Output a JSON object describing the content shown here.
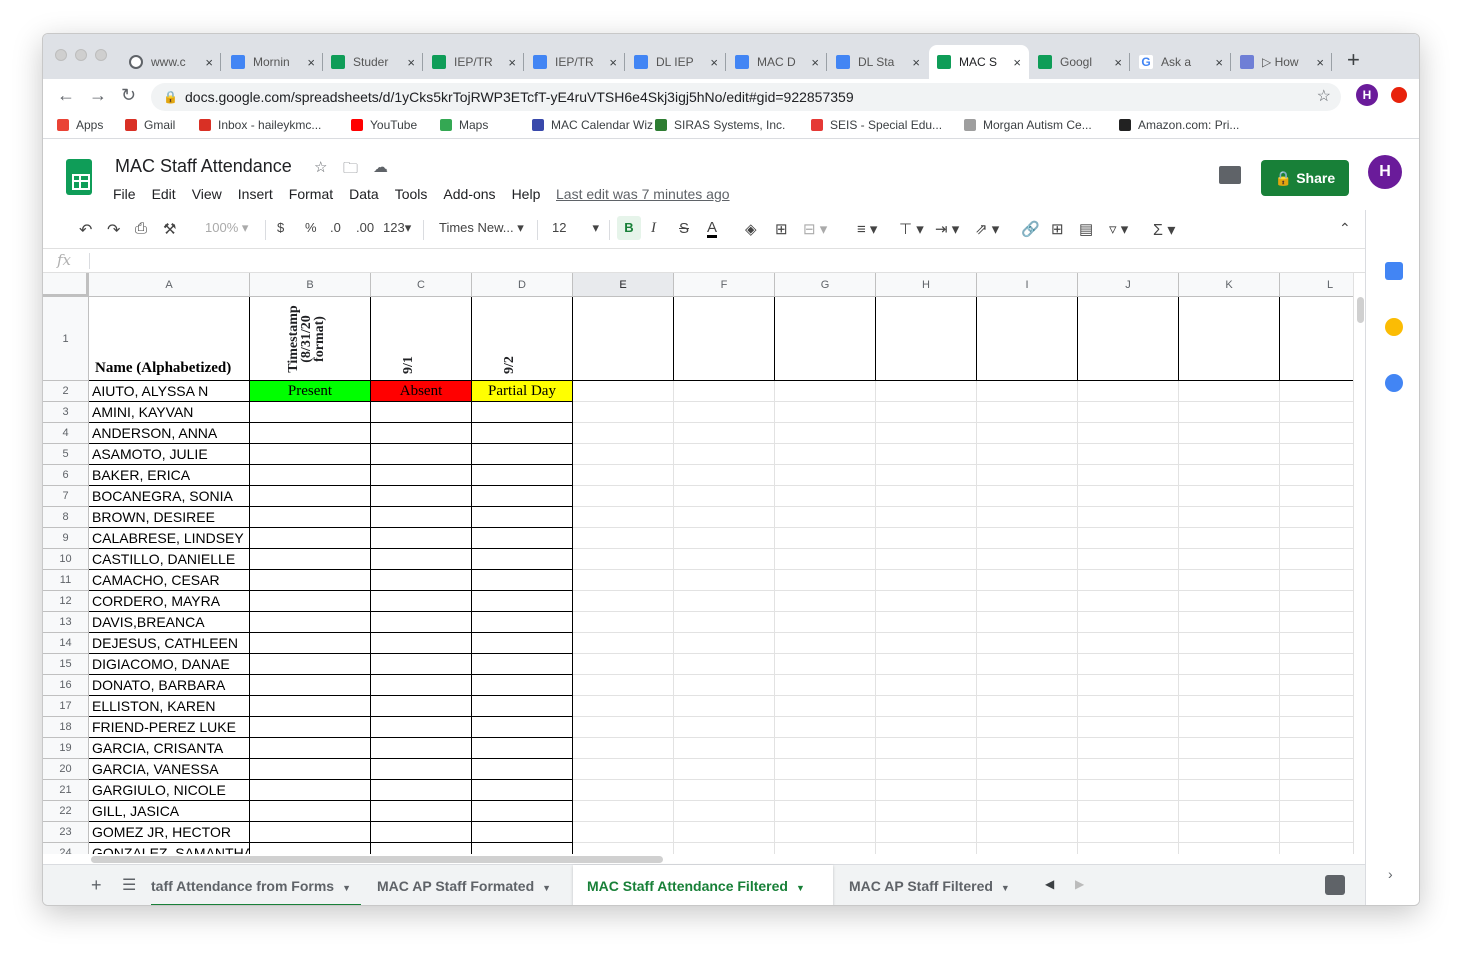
{
  "browser": {
    "tabs": [
      {
        "title": "www.c",
        "icon": "web-icon"
      },
      {
        "title": "Mornin",
        "icon": "docs-icon"
      },
      {
        "title": "Studer",
        "icon": "sheets-icon"
      },
      {
        "title": "IEP/TR",
        "icon": "sheets-icon"
      },
      {
        "title": "IEP/TR",
        "icon": "docs-icon"
      },
      {
        "title": "DL IEP",
        "icon": "docs-icon"
      },
      {
        "title": "MAC D",
        "icon": "docs-icon"
      },
      {
        "title": "DL Sta",
        "icon": "docs-icon"
      },
      {
        "title": "MAC S",
        "icon": "sheets-icon"
      },
      {
        "title": "Googl",
        "icon": "sheets-icon"
      },
      {
        "title": "Ask a",
        "icon": "google-icon"
      },
      {
        "title": "▷ How",
        "icon": "image-icon"
      }
    ],
    "new_tab": "+",
    "url": "docs.google.com/spreadsheets/d/1yCks5krTojRWP3ETcfT-yE4ruVTSH6e4Skj3igj5hNo/edit#gid=922857359",
    "avatar_letter": "H",
    "bookmarks": [
      "Apps",
      "Gmail",
      "Inbox - haileykmc...",
      "YouTube",
      "Maps",
      "MAC Calendar Wiz",
      "SIRAS Systems, Inc.",
      "SEIS - Special Edu...",
      "Morgan Autism Ce...",
      "Amazon.com: Pri..."
    ]
  },
  "doc": {
    "title": "MAC Staff Attendance",
    "menu": [
      "File",
      "Edit",
      "View",
      "Insert",
      "Format",
      "Data",
      "Tools",
      "Add-ons",
      "Help"
    ],
    "last_edit": "Last edit was 7 minutes ago",
    "share_label": "Share",
    "avatar_letter": "H"
  },
  "toolbar": {
    "zoom": "100%",
    "currency": "$",
    "percent": "%",
    "dec_less": ".0",
    "dec_more": ".00",
    "more_formats": "123",
    "font": "Times New...",
    "font_size": "12",
    "bold": "B",
    "italic": "I",
    "strike": "S",
    "text_color": "A",
    "fx": "fx"
  },
  "grid": {
    "columns": [
      "A",
      "B",
      "C",
      "D",
      "E",
      "F",
      "G",
      "H",
      "I",
      "J",
      "K",
      "L"
    ],
    "selected_column": "E",
    "header_row": {
      "name": "Name (Alphabetized)",
      "timestamp": "Timestamp (8/31/20 format)",
      "d1": "9/1",
      "d2": "9/2"
    },
    "legend": {
      "present": "Present",
      "absent": "Absent",
      "partial": "Partial Day",
      "present_color": "#00ff00",
      "absent_color": "#ff0000",
      "partial_color": "#ffff00"
    },
    "row_numbers": [
      "1",
      "2",
      "3",
      "4",
      "5",
      "6",
      "7",
      "8",
      "9",
      "10",
      "11",
      "12",
      "13",
      "14",
      "15",
      "16",
      "17",
      "18",
      "19",
      "20",
      "21",
      "22",
      "23",
      "24"
    ],
    "names": [
      "AIUTO, ALYSSA N",
      "AMINI, KAYVAN",
      "ANDERSON, ANNA",
      "ASAMOTO, JULIE",
      "BAKER, ERICA",
      "BOCANEGRA, SONIA",
      "BROWN, DESIREE",
      "CALABRESE, LINDSEY",
      "CASTILLO, DANIELLE",
      "CAMACHO, CESAR",
      "CORDERO, MAYRA",
      "DAVIS,BREANCA",
      "DEJESUS, CATHLEEN",
      "DIGIACOMO, DANAE",
      "DONATO, BARBARA",
      "ELLISTON, KAREN",
      "FRIEND-PEREZ LUKE",
      "GARCIA, CRISANTA",
      "GARCIA, VANESSA",
      "GARGIULO, NICOLE",
      "GILL, JASICA",
      "GOMEZ JR, HECTOR",
      "GONZALEZ, SAMANTHA"
    ]
  },
  "sheet_tabs": [
    {
      "label": "MAC Staff Attendance from Forms",
      "active": false
    },
    {
      "label": "MAC AP Staff Formated",
      "active": false
    },
    {
      "label": "MAC Staff Attendance Filtered",
      "active": true
    },
    {
      "label": "MAC AP Staff Filtered",
      "active": false
    }
  ],
  "colors": {
    "accent": "#188038",
    "selection": "#1a73e8",
    "docs_blue": "#4285f4",
    "sheets_green": "#0f9d58"
  }
}
